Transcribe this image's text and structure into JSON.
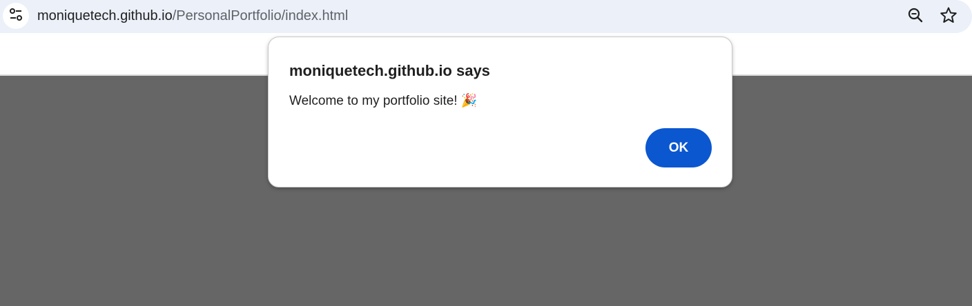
{
  "browser": {
    "url_host": "moniquetech.github.io",
    "url_path": "/PersonalPortfolio/index.html",
    "icons": {
      "site_info": "tune-icon",
      "zoom": "zoom-out-icon",
      "bookmark": "star-icon"
    }
  },
  "dialog": {
    "title": "moniquetech.github.io says",
    "message": "Welcome to my portfolio site! 🎉",
    "ok_label": "OK",
    "accent_color": "#0b57d0"
  },
  "page": {
    "background_color": "#666666"
  }
}
